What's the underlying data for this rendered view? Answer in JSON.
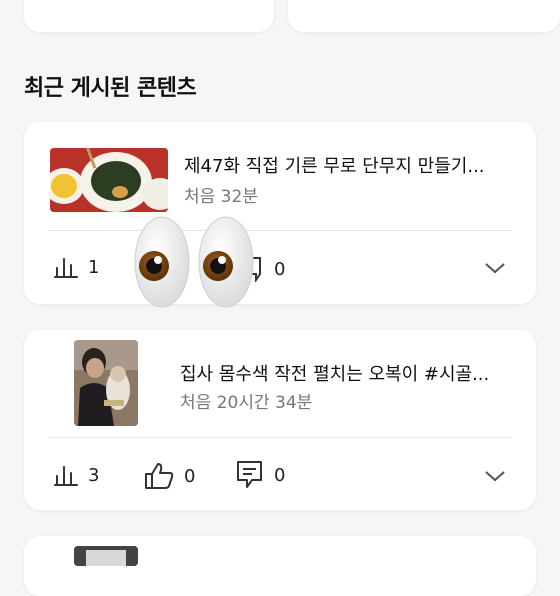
{
  "section_title": "최근 게시된 콘텐츠",
  "posts": [
    {
      "title": "제47화 직접 기른 무로 단무지 만들기...",
      "subtitle": "처음 32분",
      "views": "1",
      "comments": "0"
    },
    {
      "title": "집사 몸수색 작전 펼치는 오복이 #시골...",
      "subtitle": "처음 20시간 34분",
      "views": "3",
      "likes": "0",
      "comments": "0"
    }
  ],
  "icons": [
    "stats-icon",
    "thumbs-up-icon",
    "comment-icon",
    "chevron-down-icon",
    "eyes-emoji"
  ]
}
